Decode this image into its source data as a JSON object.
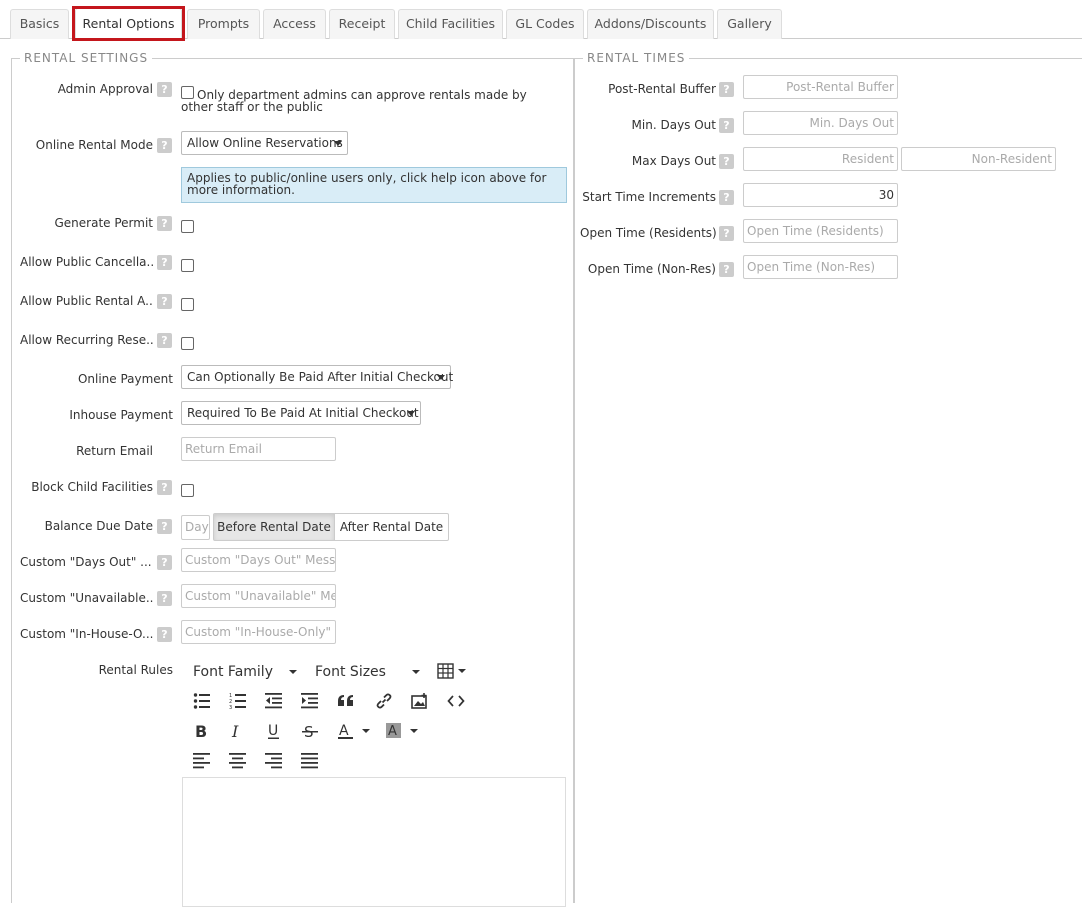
{
  "tabs": [
    {
      "label": "Basics"
    },
    {
      "label": "Rental Options"
    },
    {
      "label": "Prompts"
    },
    {
      "label": "Access"
    },
    {
      "label": "Receipt"
    },
    {
      "label": "Child Facilities"
    },
    {
      "label": "GL Codes"
    },
    {
      "label": "Addons/Discounts"
    },
    {
      "label": "Gallery"
    }
  ],
  "rental_settings": {
    "legend": "RENTAL SETTINGS",
    "admin_approval": {
      "label": "Admin Approval",
      "checkbox_text": "Only department admins can approve rentals made by other staff or the public"
    },
    "online_rental_mode": {
      "label": "Online Rental Mode",
      "value": "Allow Online Reservations",
      "info": "Applies to public/online users only, click help icon above for more information."
    },
    "generate_permit": {
      "label": "Generate Permit"
    },
    "allow_public_cancellation": {
      "label": "Allow Public Cancella..."
    },
    "allow_public_rental": {
      "label": "Allow Public Rental A..."
    },
    "allow_recurring": {
      "label": "Allow Recurring Rese..."
    },
    "online_payment": {
      "label": "Online Payment",
      "value": "Can Optionally Be Paid After Initial Checkout"
    },
    "inhouse_payment": {
      "label": "Inhouse Payment",
      "value": "Required To Be Paid At Initial Checkout"
    },
    "return_email": {
      "label": "Return Email",
      "placeholder": "Return Email"
    },
    "block_child": {
      "label": "Block Child Facilities"
    },
    "balance_due": {
      "label": "Balance Due Date",
      "day_placeholder": "Day",
      "before": "Before Rental Date",
      "after": "After Rental Date"
    },
    "custom_days_out": {
      "label": "Custom \"Days Out\" ...",
      "placeholder": "Custom \"Days Out\" Messa"
    },
    "custom_unavailable": {
      "label": "Custom \"Unavailable...",
      "placeholder": "Custom \"Unavailable\" Mes"
    },
    "custom_inhouse": {
      "label": "Custom \"In-House-O...",
      "placeholder": "Custom \"In-House-Only\" N"
    },
    "rental_rules": {
      "label": "Rental Rules",
      "font_family": "Font Family",
      "font_sizes": "Font Sizes"
    }
  },
  "rental_times": {
    "legend": "RENTAL TIMES",
    "post_buffer": {
      "label": "Post-Rental Buffer",
      "placeholder": "Post-Rental Buffer"
    },
    "min_days": {
      "label": "Min. Days Out",
      "placeholder": "Min. Days Out"
    },
    "max_days": {
      "label": "Max Days Out",
      "resident_placeholder": "Resident",
      "nonresident_placeholder": "Non-Resident"
    },
    "start_increments": {
      "label": "Start Time Increments",
      "value": "30"
    },
    "open_res": {
      "label": "Open Time (Residents)",
      "placeholder": "Open Time (Residents)"
    },
    "open_nonres": {
      "label": "Open Time (Non-Res)",
      "placeholder": "Open Time (Non-Res)"
    }
  },
  "help_glyph": "?",
  "colors": {
    "highlight": "#c4161c",
    "info_bg": "#d9edf7"
  }
}
